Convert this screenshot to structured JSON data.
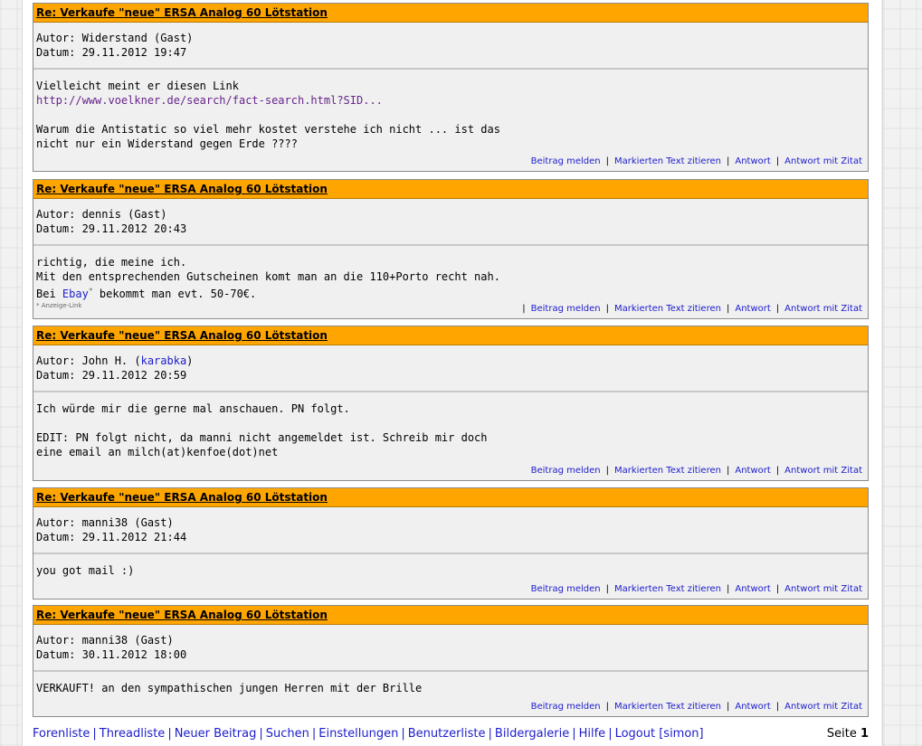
{
  "posts": [
    {
      "title": "Re: Verkaufe \"neue\" ERSA Analog 60 Lötstation",
      "author_prefix": "Autor: ",
      "author_name": "Widerstand",
      "author_suffix": " (Gast)",
      "date_line": "Datum: 29.11.2012 19:47",
      "body_line1": "Vielleicht meint er diesen Link",
      "link": "http://www.voelkner.de/search/fact-search.html?SID...",
      "body_line3": "Warum die Antistatic so viel mehr kostet verstehe ich nicht ... ist das",
      "body_line4": "nicht nur ein Widerstand gegen Erde ????"
    },
    {
      "title": "Re: Verkaufe \"neue\" ERSA Analog 60 Lötstation",
      "author_prefix": "Autor: ",
      "author_name": "dennis",
      "author_suffix": " (Gast)",
      "date_line": "Datum: 29.11.2012 20:43",
      "body_line1": "richtig, die meine ich.",
      "body_line2": "Mit den entsprechenden Gutscheinen komt man an die 110+Porto recht nah.",
      "body_pre": "Bei ",
      "ebay_link": "Ebay",
      "ebay_star": "*",
      "body_post": " bekommt man evt. 50-70€.",
      "ad_note": "* Anzeige-Link"
    },
    {
      "title": "Re: Verkaufe \"neue\" ERSA Analog 60 Lötstation",
      "author_prefix": "Autor: John H. (",
      "author_link": "karabka",
      "author_suffix": ")",
      "date_line": "Datum: 29.11.2012 20:59",
      "body_line1": "Ich würde mir die gerne mal anschauen. PN folgt.",
      "body_line3": "EDIT: PN folgt nicht, da manni nicht angemeldet ist. Schreib mir doch",
      "body_line4": "eine email an milch(at)kenfoe(dot)net"
    },
    {
      "title": "Re: Verkaufe \"neue\" ERSA Analog 60 Lötstation",
      "author_line": "Autor: manni38 (Gast)",
      "date_line": "Datum: 29.11.2012 21:44",
      "body_line1": "you got mail :)"
    },
    {
      "title": "Re: Verkaufe \"neue\" ERSA Analog 60 Lötstation",
      "author_line": "Autor: manni38 (Gast)",
      "date_line": "Datum: 30.11.2012 18:00",
      "body_line1": "VERKAUFT! an den sympathischen jungen Herren mit der Brille"
    }
  ],
  "actions": {
    "report": "Beitrag melden",
    "quote_marked": "Markierten Text zitieren",
    "reply": "Antwort",
    "reply_quote": "Antwort mit Zitat",
    "sep": "|"
  },
  "footer": {
    "links": [
      "Forenliste",
      "Threadliste",
      "Neuer Beitrag",
      "Suchen",
      "Einstellungen",
      "Benutzerliste",
      "Bildergalerie",
      "Hilfe",
      "Logout [simon]"
    ],
    "page_label": "Seite ",
    "page_number": "1"
  }
}
